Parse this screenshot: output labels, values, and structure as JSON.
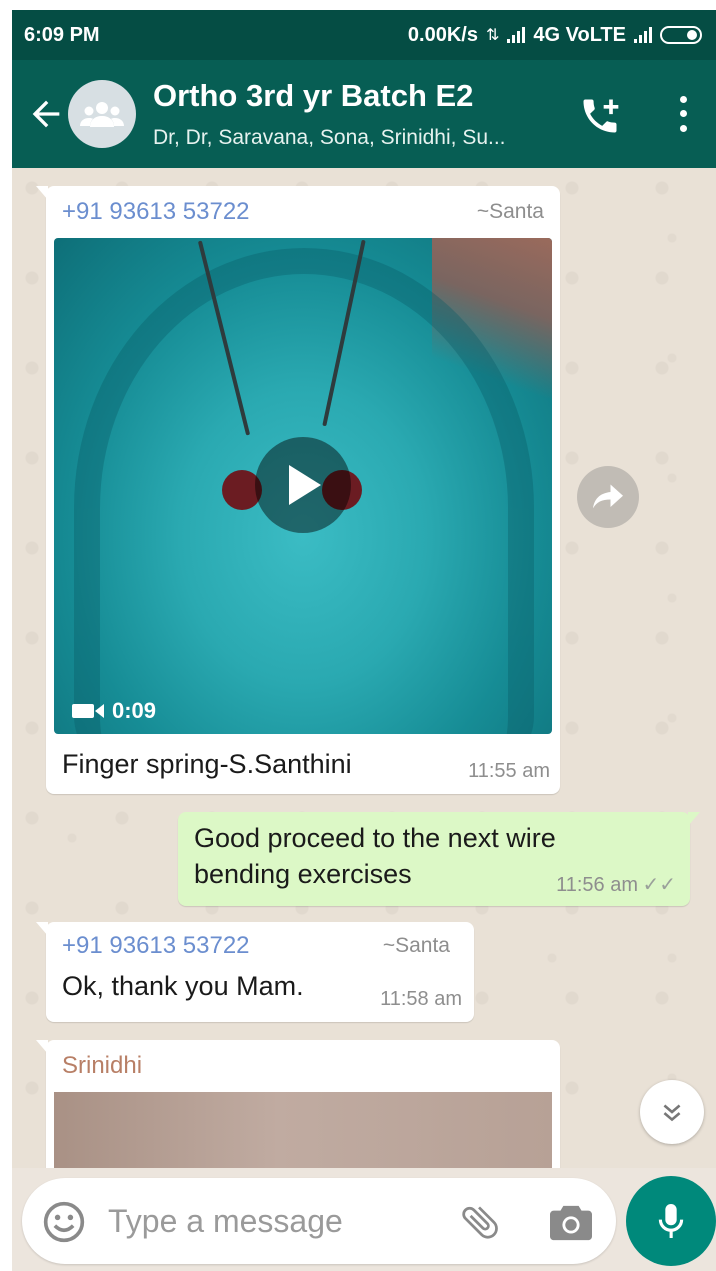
{
  "status_bar": {
    "time": "6:09 PM",
    "net_speed": "0.00K/s",
    "network": "4G VoLTE"
  },
  "header": {
    "title": "Ortho 3rd yr Batch E2",
    "members": "Dr, Dr, Saravana, Sona, Srinidhi, Su...",
    "icons": [
      "back-arrow-icon",
      "group-avatar-icon",
      "add-call-icon",
      "more-vert-icon"
    ]
  },
  "messages": [
    {
      "type": "video",
      "sender": "+91 93613 53722",
      "push_name": "~Santa",
      "duration": "0:09",
      "caption": "Finger spring-S.Santhini",
      "time": "11:55 am"
    },
    {
      "type": "text",
      "direction": "outgoing",
      "text_line1": "Good proceed to the next wire",
      "text_line2": "bending exercises",
      "time": "11:56 am",
      "status": "✓✓"
    },
    {
      "type": "text",
      "direction": "incoming",
      "sender": "+91 93613 53722",
      "push_name": "~Santa",
      "text": "Ok, thank you Mam.",
      "time": "11:58 am"
    },
    {
      "type": "image",
      "sender": "Srinidhi"
    }
  ],
  "input": {
    "placeholder": "Type a message"
  },
  "colors": {
    "header": "#075e54",
    "status_bar": "#054d44",
    "outgoing_bubble": "#dcf8c6",
    "sender_phone": "#6b8ecf",
    "sender_srinidhi": "#b87f66",
    "mic_button": "#00897b"
  }
}
